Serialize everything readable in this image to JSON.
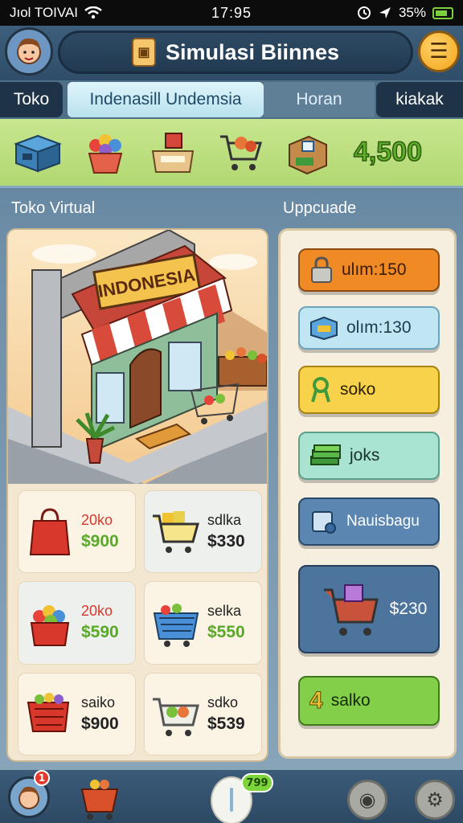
{
  "status": {
    "carrier": "Jıol TOIVAI",
    "time": "17:95",
    "battery": "35%"
  },
  "header": {
    "title": "Simulasi Biinnes"
  },
  "tabs": [
    {
      "label": "Toko"
    },
    {
      "label": "Indenasill Undemsia"
    },
    {
      "label": "Horan"
    },
    {
      "label": "kiakak"
    }
  ],
  "resources": {
    "coins": "4,500"
  },
  "sections": {
    "left": "Toko Virtual",
    "right": "Uppcuade"
  },
  "scene": {
    "shop_sign": "INDONESIA"
  },
  "products": [
    {
      "name": "20ko",
      "price": "$900",
      "name_color": "#d43a2c",
      "price_color": "#5aa82a",
      "icon": "red-bag-icon"
    },
    {
      "name": "sdlka",
      "price": "$330",
      "name_color": "#222",
      "price_color": "#222",
      "icon": "cart-icon"
    },
    {
      "name": "20ko",
      "price": "$590",
      "name_color": "#d43a2c",
      "price_color": "#5aa82a",
      "icon": "fruit-basket-icon"
    },
    {
      "name": "selka",
      "price": "$550",
      "name_color": "#222",
      "price_color": "#5aa82a",
      "icon": "blue-basket-icon"
    },
    {
      "name": "saiko",
      "price": "$900",
      "name_color": "#222",
      "price_color": "#222",
      "icon": "produce-cart-icon"
    },
    {
      "name": "sdko",
      "price": "$539",
      "name_color": "#222",
      "price_color": "#222",
      "icon": "veggie-cart-icon"
    }
  ],
  "upgrades": [
    {
      "label": "ulım:150",
      "icon": "padlock-icon"
    },
    {
      "label": "olım:130",
      "icon": "box-icon"
    },
    {
      "label": "soko",
      "icon": "ribbon-icon"
    },
    {
      "label": "joks",
      "icon": "cash-stack-icon"
    },
    {
      "label": "Nauisbagu",
      "icon": "machine-icon"
    },
    {
      "label": "$230",
      "icon": "shopping-cart-icon"
    },
    {
      "label": "salko",
      "icon": "number-four-icon"
    }
  ],
  "bottom": {
    "notification_count": "1",
    "pill_badge": "799"
  },
  "colors": {
    "accent": "#f3a318",
    "coin_green": "#5fae2a",
    "panel": "#f3e7d1"
  }
}
